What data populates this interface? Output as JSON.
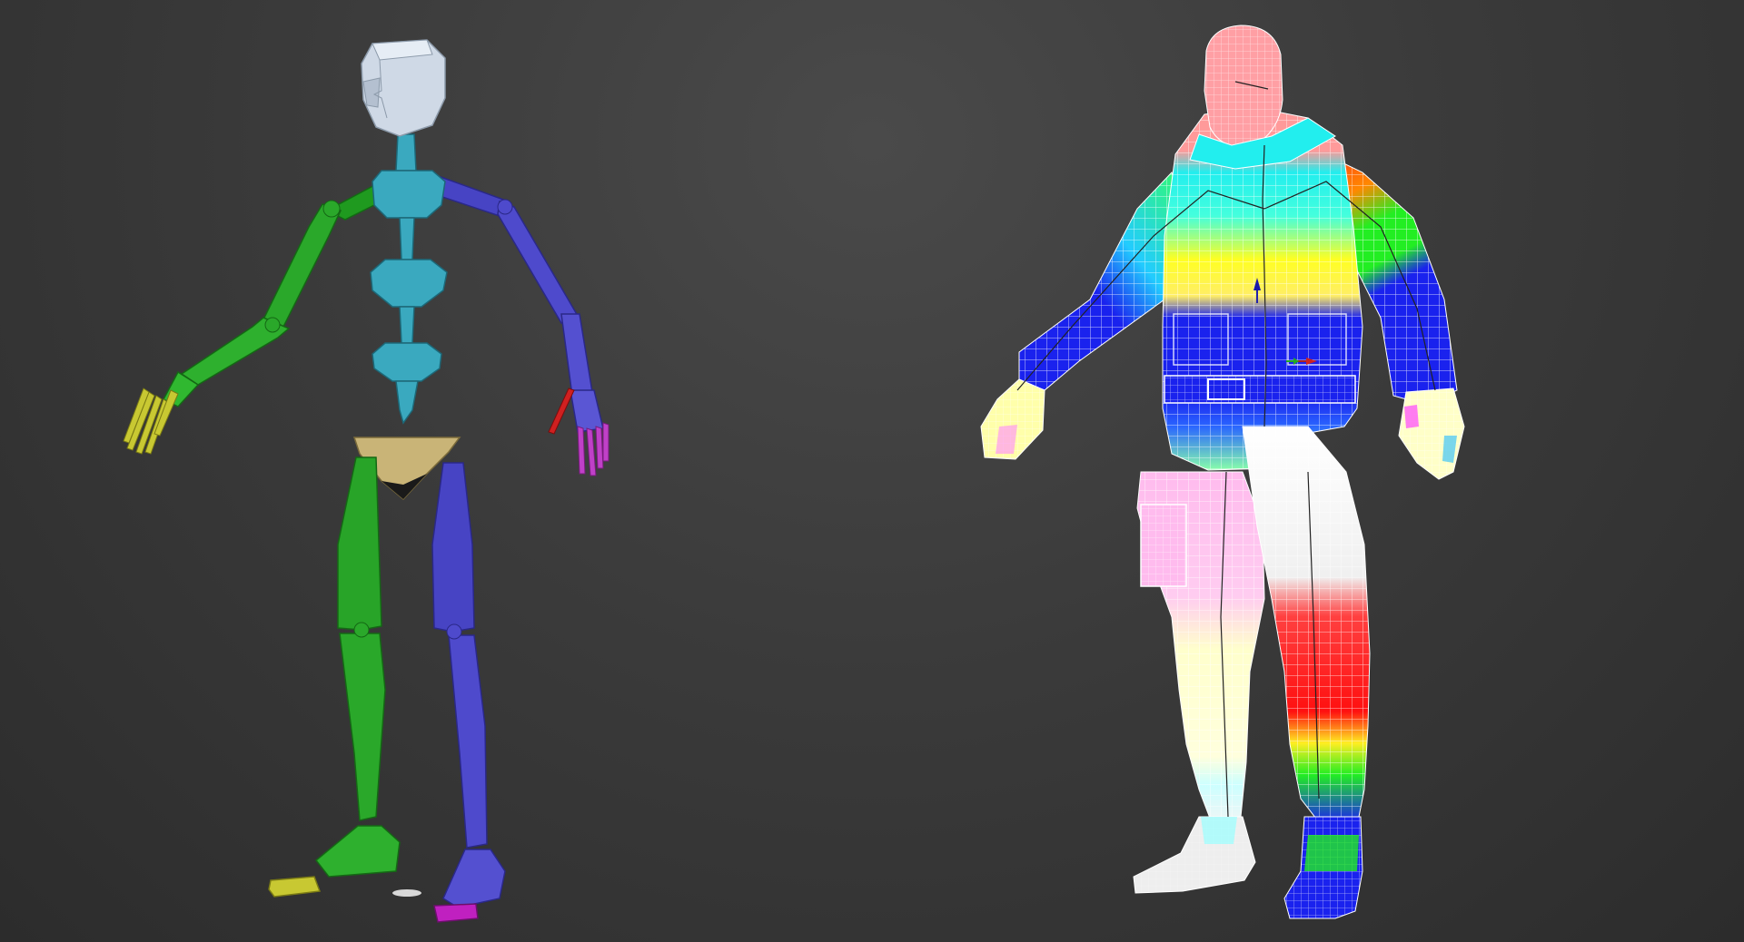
{
  "viewport": {
    "background_top": "#474747",
    "background_bottom": "#2c2c2c"
  },
  "biped_skeleton": {
    "colors": {
      "head": "#cdd8e6",
      "spine": "#3aa9bf",
      "left_arm": "#27a027",
      "left_leg": "#27a027",
      "right_arm": "#4b47c4",
      "right_leg": "#4b47c4",
      "pelvis": "#c9b477",
      "left_fingers": "#c8c832",
      "right_fingers": "#c040c8",
      "right_thumb": "#d02020",
      "left_toe": "#c8c832",
      "right_toe": "#c020c0"
    }
  },
  "skinned_character": {
    "wireframe_color": "#ffffff",
    "weight_gradient": [
      "#0000ff",
      "#00ffff",
      "#00ff00",
      "#ffff00",
      "#ff0000"
    ],
    "icons": [
      "transform-gizmo-icon"
    ]
  }
}
